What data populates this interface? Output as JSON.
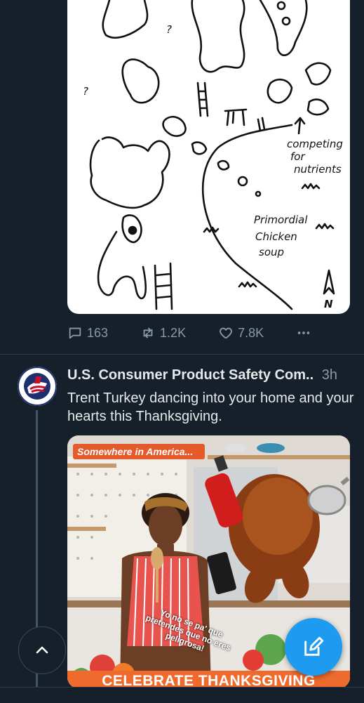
{
  "post1": {
    "drawing": {
      "labels": {
        "competing": "competing",
        "for": "for",
        "nutrients": "nutrients",
        "primordial": "Primordial",
        "chicken": "Chicken",
        "soup": "soup",
        "q1": "?",
        "q2": "?",
        "north": "N"
      }
    },
    "replies": "163",
    "reposts": "1.2K",
    "likes": "7.8K"
  },
  "post2": {
    "author": "U.S. Consumer Product Safety Com..",
    "time": "3h",
    "text": "Trent Turkey dancing into your home and your hearts this Thanksgiving.",
    "image": {
      "banner": "Somewhere in America...",
      "speech": "Yo no se pa' que pretendes que no eres peligrosa!",
      "footer": "CELEBRATE THANKSGIVING"
    }
  },
  "colors": {
    "background": "#15202b",
    "accent": "#1d9bf0",
    "muted": "#8b98a5",
    "divider": "#2f3b47"
  },
  "icons": {
    "reply": "reply-icon",
    "repost": "repost-icon",
    "like": "heart-icon",
    "more": "more-icon",
    "scroll_top": "chevron-up-icon",
    "compose": "compose-icon"
  }
}
